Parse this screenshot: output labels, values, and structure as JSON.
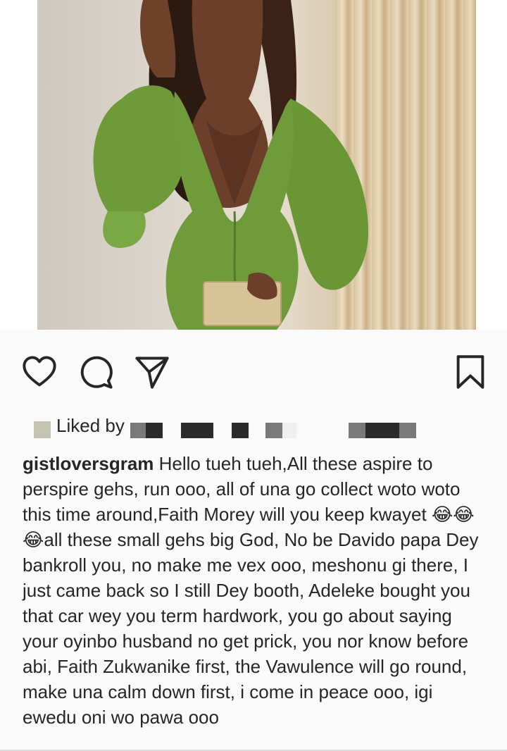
{
  "post": {
    "liked_by_label": "Liked by",
    "username": "gistloversgram",
    "caption_text": " Hello tueh tueh,All these aspire to perspire gehs, run ooo, all of una go collect woto woto this time around,Faith Morey will you keep kwayet 😂😂😂all these small gehs big God, No be Davido papa Dey bankroll you, no make me vex ooo, meshonu gi there, I just came back so I still Dey booth, Adeleke bought you that car wey you term hardwork, you go about saying your oyinbo husband no get prick, you nor know before abi, Faith Zukwanike first, the Vawulence will go round, make una calm down first, i come in peace ooo, igi ewedu oni wo pawa ooo"
  },
  "icons": {
    "like": "heart-icon",
    "comment": "comment-icon",
    "share": "send-icon",
    "save": "bookmark-icon"
  },
  "colors": {
    "background": "#fafafa",
    "text": "#262626",
    "dress": "#6e9a3a"
  }
}
